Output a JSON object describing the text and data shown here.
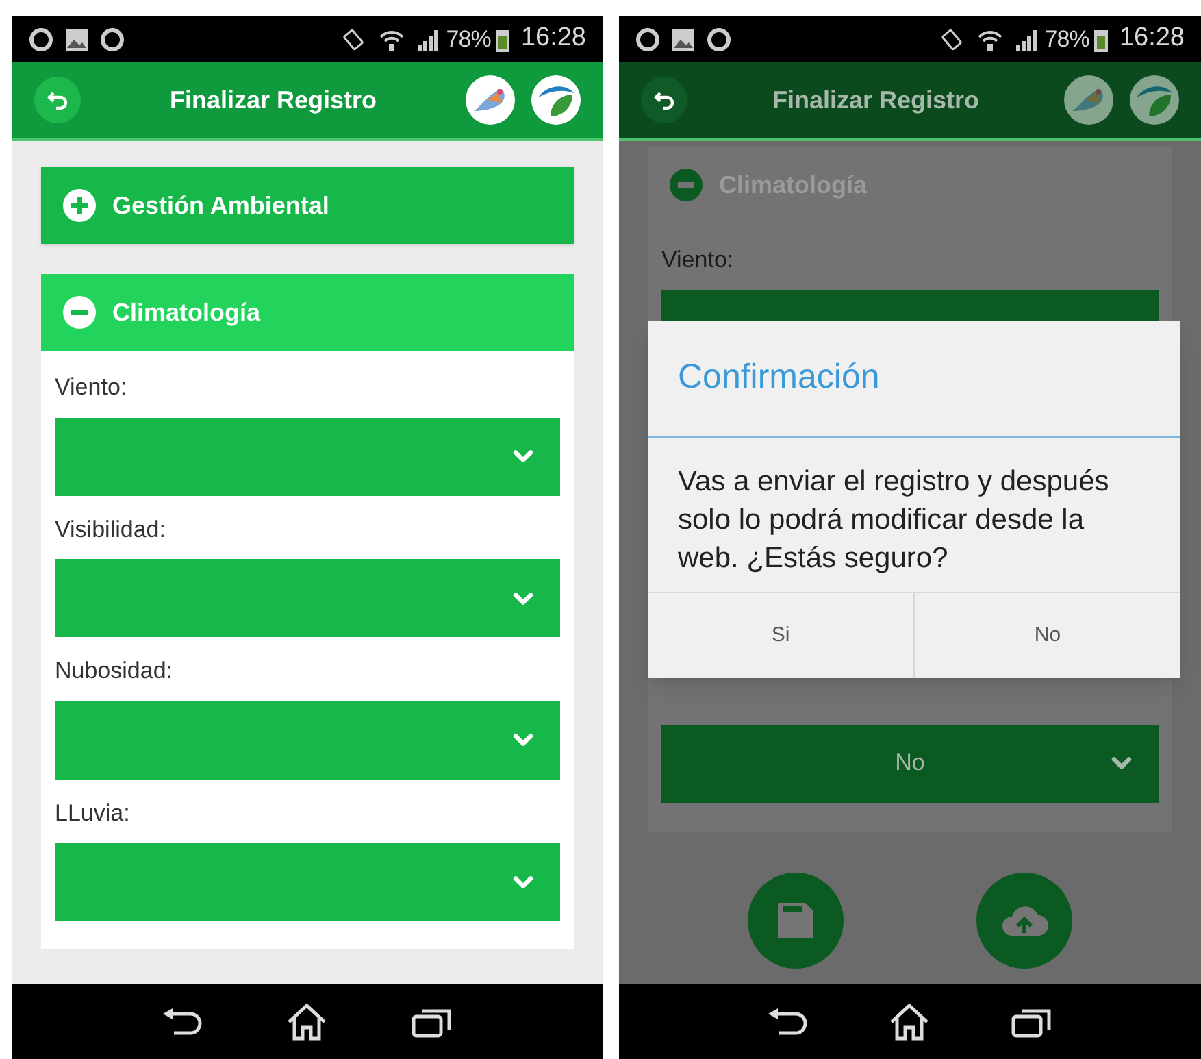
{
  "screens": [
    {
      "dimmed": false,
      "status_bar": {
        "battery": "78%",
        "time": "16:28"
      },
      "app_bar": {
        "title": "Finalizar Registro"
      },
      "sections": [
        {
          "title": "Gestión Ambiental",
          "expanded": false
        },
        {
          "title": "Climatología",
          "expanded": true,
          "fields": [
            {
              "label": "Viento:"
            },
            {
              "label": "Visibilidad:"
            },
            {
              "label": "Nubosidad:"
            },
            {
              "label": "LLuvia:"
            }
          ]
        }
      ]
    },
    {
      "dimmed": true,
      "status_bar": {
        "battery": "78%",
        "time": "16:28"
      },
      "app_bar": {
        "title": "Finalizar Registro"
      },
      "sections": [
        {
          "title": "Climatología",
          "expanded": true,
          "fields": [
            {
              "label": "Viento:"
            },
            {
              "value": "No"
            }
          ]
        }
      ],
      "dialog": {
        "title": "Confirmación",
        "message": "Vas a enviar el registro y después solo lo podrá modificar desde la web. ¿Estás seguro?",
        "buttons": [
          "Si",
          "No"
        ]
      },
      "actions": [
        {
          "kind": "save"
        },
        {
          "kind": "upload"
        }
      ]
    }
  ]
}
